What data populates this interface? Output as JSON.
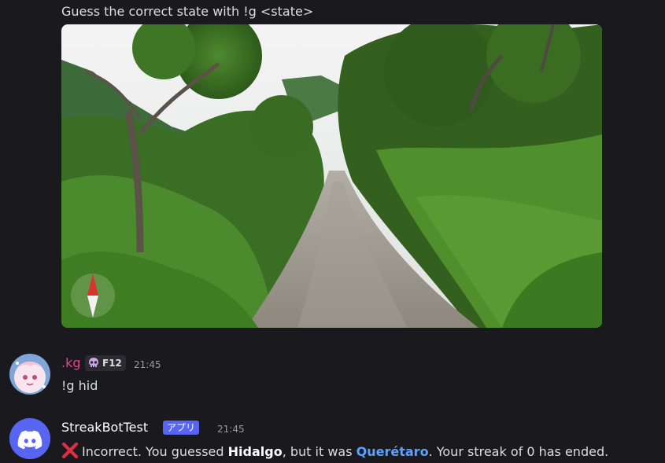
{
  "bot_prompt": {
    "text": "Guess the correct state with !g <state>"
  },
  "image": {
    "alt": "street view: dirt road through forest",
    "compass_icon": "compass-icon"
  },
  "message_user": {
    "username": ".kg",
    "username_color": "#e8438f",
    "role_label": "F12",
    "role_icon": "skull-icon",
    "timestamp": "21:45",
    "content": "!g hid"
  },
  "message_bot": {
    "username": "StreakBotTest",
    "app_tag": "アプリ",
    "timestamp": "21:45",
    "icon": "cross-mark-icon",
    "part1": "Incorrect. You guessed ",
    "guessed": "Hidalgo",
    "part2": ", but it was ",
    "answer": "Querétaro",
    "part3": ". Your streak of 0 has ended."
  },
  "colors": {
    "background": "#1a1a1e",
    "text": "#dbdee1",
    "link_blue": "#5aa2ff",
    "app_tag": "#5865f2",
    "discord_blurple": "#5865f2"
  }
}
